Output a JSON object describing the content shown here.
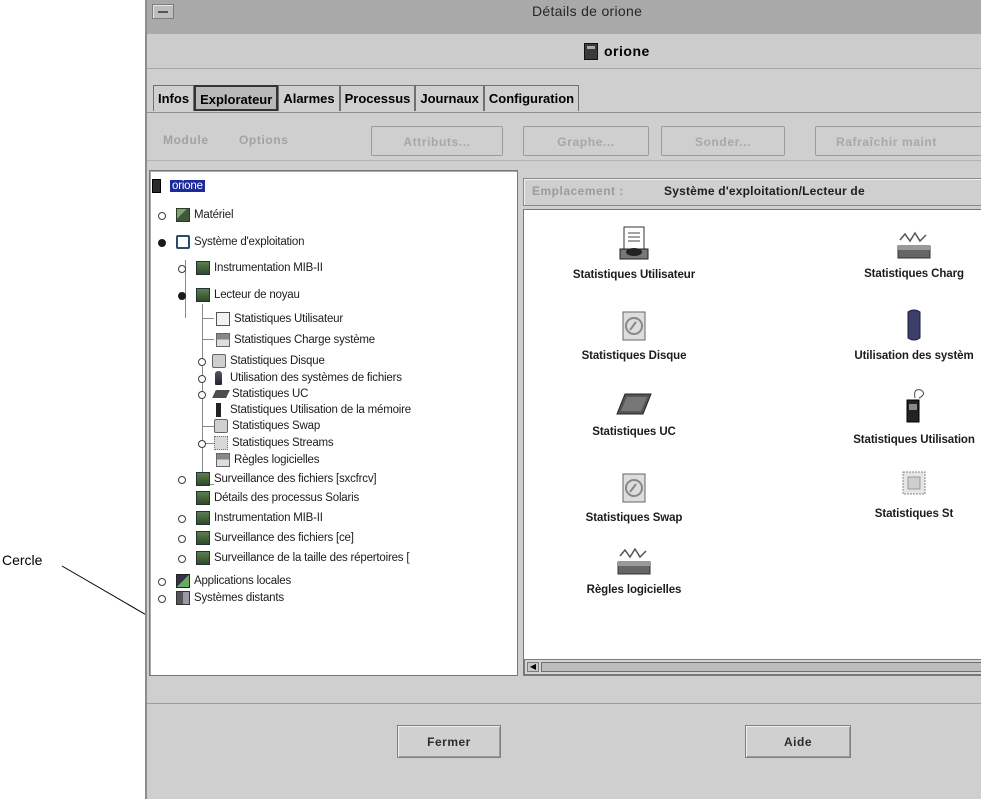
{
  "callout": {
    "label": "Cercle"
  },
  "window": {
    "title": "Détails de orione",
    "subtitle": "orione"
  },
  "tabs": [
    {
      "label": "Infos",
      "active": false
    },
    {
      "label": "Explorateur",
      "active": true
    },
    {
      "label": "Alarmes",
      "active": false
    },
    {
      "label": "Processus",
      "active": false
    },
    {
      "label": "Journaux",
      "active": false
    },
    {
      "label": "Configuration",
      "active": false
    }
  ],
  "toolbar": {
    "menu_module": "Module",
    "menu_options": "Options",
    "btn_attributes": "Attributs...",
    "btn_graph": "Graphe...",
    "btn_probe": "Sonder...",
    "btn_refresh": "Rafraîchir maint"
  },
  "tree": {
    "items": [
      {
        "label": "orione",
        "icon": "server-icon",
        "selected": true
      },
      {
        "label": "Matériel",
        "icon": "hardware-icon",
        "node": "open"
      },
      {
        "label": "Système d'exploitation",
        "icon": "os-icon",
        "node": "filled"
      },
      {
        "label": "Instrumentation MIB-II",
        "icon": "module-icon",
        "node": "open"
      },
      {
        "label": "Lecteur de noyau",
        "icon": "module-icon",
        "node": "filled"
      },
      {
        "label": "Statistiques Utilisateur",
        "icon": "user-stats-icon"
      },
      {
        "label": "Statistiques Charge système",
        "icon": "system-load-icon"
      },
      {
        "label": "Statistiques Disque",
        "icon": "disk-icon",
        "node": "open"
      },
      {
        "label": "Utilisation des systèmes de fichiers",
        "icon": "filesystem-icon",
        "node": "open"
      },
      {
        "label": "Statistiques UC",
        "icon": "cpu-icon",
        "node": "open"
      },
      {
        "label": "Statistiques Utilisation de la mémoire",
        "icon": "memory-icon"
      },
      {
        "label": "Statistiques Swap",
        "icon": "swap-icon"
      },
      {
        "label": "Statistiques Streams",
        "icon": "streams-icon",
        "node": "open"
      },
      {
        "label": "Règles logicielles",
        "icon": "rules-icon"
      },
      {
        "label": "Surveillance des fichiers [sxcfrcv]",
        "icon": "module-icon",
        "node": "open"
      },
      {
        "label": "Détails des processus Solaris",
        "icon": "module-icon"
      },
      {
        "label": "Instrumentation MIB-II",
        "icon": "module-icon",
        "node": "open"
      },
      {
        "label": "Surveillance des fichiers [ce]",
        "icon": "module-icon",
        "node": "open"
      },
      {
        "label": "Surveillance de la taille des répertoires [",
        "icon": "module-icon",
        "node": "open"
      },
      {
        "label": "Applications locales",
        "icon": "local-apps-icon",
        "node": "open"
      },
      {
        "label": "Systèmes distants",
        "icon": "remote-systems-icon",
        "node": "open"
      }
    ]
  },
  "location": {
    "label": "Emplacement :",
    "value": "Système d'exploitation/Lecteur de"
  },
  "grid": {
    "items": [
      {
        "label": "Statistiques Utilisateur",
        "icon": "user-stats-icon"
      },
      {
        "label": "Statistiques Charg",
        "icon": "system-load-icon"
      },
      {
        "label": "Statistiques Disque",
        "icon": "disk-icon"
      },
      {
        "label": "Utilisation des systèm",
        "icon": "filesystem-icon"
      },
      {
        "label": "Statistiques UC",
        "icon": "cpu-icon"
      },
      {
        "label": "Statistiques Utilisation",
        "icon": "memory-icon"
      },
      {
        "label": "Statistiques Swap",
        "icon": "swap-icon"
      },
      {
        "label": "Statistiques St",
        "icon": "streams-icon"
      },
      {
        "label": "Règles logicielles",
        "icon": "rules-icon"
      }
    ]
  },
  "buttons": {
    "close": "Fermer",
    "help": "Aide"
  }
}
